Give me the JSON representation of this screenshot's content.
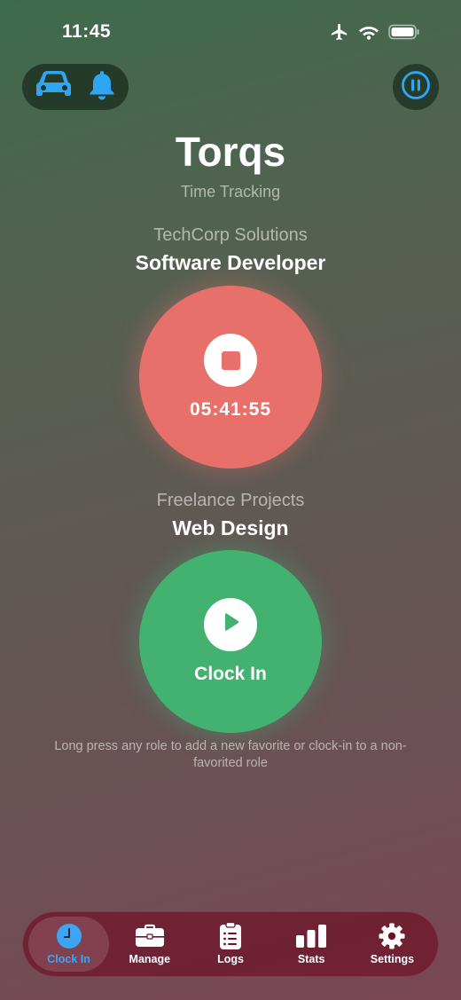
{
  "status_bar": {
    "time": "11:45",
    "icons": [
      "airplane-icon",
      "wifi-icon",
      "battery-icon"
    ]
  },
  "toolbar": {
    "left_icons": [
      "car-icon",
      "bell-icon"
    ],
    "right_icon": "pause-circle-icon",
    "accent": "#2fa6f2"
  },
  "header": {
    "title": "Torqs",
    "subtitle": "Time Tracking"
  },
  "roles": [
    {
      "company": "TechCorp Solutions",
      "role": "Software Developer",
      "state": "running",
      "timer": "05:41:55",
      "color": "#e8706a",
      "icon": "stop-icon"
    },
    {
      "company": "Freelance Projects",
      "role": "Web Design",
      "state": "idle",
      "action_label": "Clock In",
      "color": "#43b271",
      "icon": "play-icon"
    }
  ],
  "hint": "Long press any role to add a new favorite or clock-in to a non-favorited role",
  "tab_bar": {
    "active_color": "#3aa6f5",
    "tabs": [
      {
        "label": "Clock In",
        "icon": "clock-icon",
        "active": true
      },
      {
        "label": "Manage",
        "icon": "briefcase-icon",
        "active": false
      },
      {
        "label": "Logs",
        "icon": "clipboard-icon",
        "active": false
      },
      {
        "label": "Stats",
        "icon": "bar-chart-icon",
        "active": false
      },
      {
        "label": "Settings",
        "icon": "gear-icon",
        "active": false
      }
    ]
  }
}
